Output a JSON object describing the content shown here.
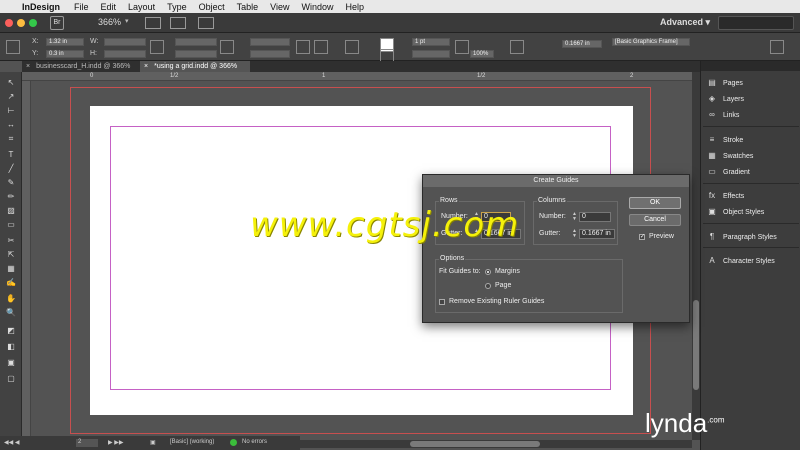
{
  "menubar": {
    "apple": "",
    "app_name": "InDesign",
    "items": [
      "File",
      "Edit",
      "Layout",
      "Type",
      "Object",
      "Table",
      "View",
      "Window",
      "Help"
    ]
  },
  "appbar": {
    "logo": "Br",
    "zoom": "366%",
    "workspace": "Advanced",
    "workspace_arrow": "▾"
  },
  "control": {
    "x_label": "X:",
    "x_value": "1.32 in",
    "y_label": "Y:",
    "y_value": "0.3 in",
    "w_label": "W:",
    "h_label": "H:",
    "stroke_weight": "1 pt",
    "scale": "100%",
    "offset": "0.1667 in",
    "style": "[Basic Graphics Frame]"
  },
  "tabs": [
    {
      "close": "×",
      "label": "businesscard_H.indd @ 366%"
    },
    {
      "close": "×",
      "label": "*using a grid.indd @ 366%"
    }
  ],
  "ruler": {
    "marks": [
      "0",
      "1/2",
      "1",
      "1/2",
      "2",
      "1/2",
      "3"
    ]
  },
  "tools": [
    "↖",
    "↗",
    "⊢",
    "↔",
    "⌗",
    "T",
    "╱",
    "✎",
    "✏",
    "▨",
    "▭",
    "✂",
    "⇱",
    "▦",
    "✍",
    "✋",
    "🔍",
    "◩",
    "◧",
    "▣",
    "▢"
  ],
  "status": {
    "page": "2",
    "style": "[Basic] (working)",
    "errors": "No errors"
  },
  "panel": {
    "items": [
      {
        "icon": "▤",
        "label": "Pages"
      },
      {
        "icon": "◈",
        "label": "Layers"
      },
      {
        "icon": "∞",
        "label": "Links"
      },
      {
        "icon": "≡",
        "label": "Stroke"
      },
      {
        "icon": "▦",
        "label": "Swatches"
      },
      {
        "icon": "▭",
        "label": "Gradient"
      },
      {
        "icon": "fx",
        "label": "Effects"
      },
      {
        "icon": "▣",
        "label": "Object Styles"
      },
      {
        "icon": "¶",
        "label": "Paragraph Styles"
      },
      {
        "icon": "A",
        "label": "Character Styles"
      }
    ]
  },
  "dialog": {
    "title": "Create Guides",
    "rows": {
      "heading": "Rows",
      "number_label": "Number:",
      "number_value": "0",
      "gutter_label": "Gutter:",
      "gutter_value": "0.1667 in"
    },
    "columns": {
      "heading": "Columns",
      "number_label": "Number:",
      "number_value": "0",
      "gutter_label": "Gutter:",
      "gutter_value": "0.1667 in"
    },
    "options": {
      "heading": "Options",
      "fit_label": "Fit Guides to:",
      "margins": "Margins",
      "page": "Page",
      "remove": "Remove Existing Ruler Guides"
    },
    "ok": "OK",
    "cancel": "Cancel",
    "preview": "Preview",
    "preview_checked": true
  },
  "watermarks": {
    "site": "www.cgtsj.com",
    "brand": "lynda",
    "brand_suffix": ".com"
  },
  "colors": {
    "margin_guide": "#c561c5",
    "bleed_guide": "#c74f4f",
    "watermark": "#f5f10a"
  }
}
